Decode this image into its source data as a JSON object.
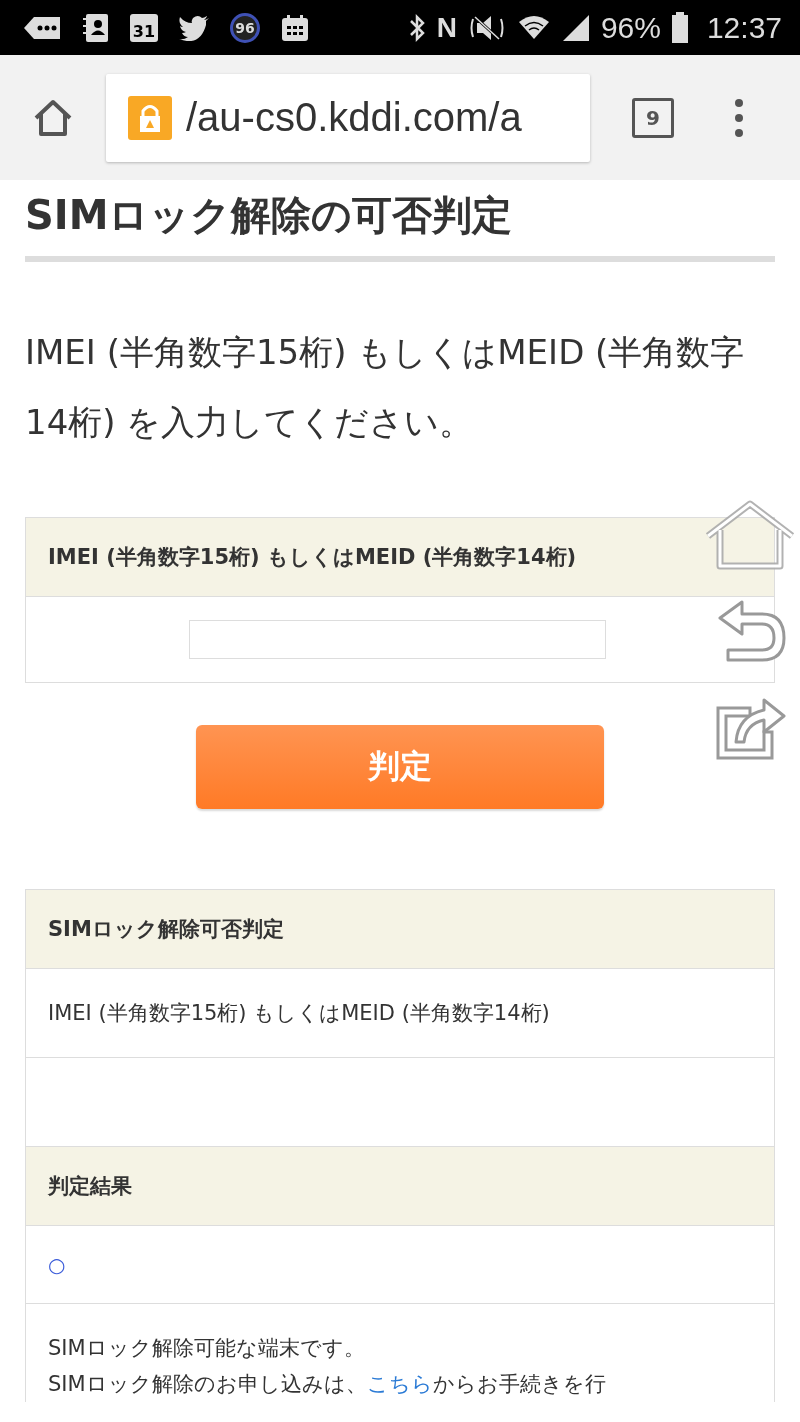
{
  "status_bar": {
    "calendar_day": "31",
    "badge_count": "96",
    "nfc": "N",
    "battery": "96%",
    "time": "12:37"
  },
  "browser": {
    "url": "/au-cs0.kddi.com/a",
    "tab_count": "9"
  },
  "page": {
    "title": "SIMロック解除の可否判定",
    "intro": "IMEI (半角数字15桁) もしくはMEID (半角数字14桁) を入力してください。",
    "form": {
      "label": "IMEI (半角数字15桁) もしくはMEID (半角数字14桁)"
    },
    "submit": "判定",
    "result_table": [
      {
        "kind": "header",
        "text": "SIMロック解除可否判定"
      },
      {
        "kind": "cell",
        "text": "IMEI (半角数字15桁) もしくはMEID (半角数字14桁)"
      },
      {
        "kind": "empty"
      },
      {
        "kind": "header",
        "text": "判定結果"
      },
      {
        "kind": "mark",
        "text": "○"
      },
      {
        "kind": "message",
        "lines": [
          {
            "parts": [
              {
                "kind": "text",
                "text": "SIMロック解除可能な端末です。"
              }
            ]
          },
          {
            "parts": [
              {
                "kind": "text",
                "text": "SIMロック解除のお申し込みは、"
              },
              {
                "kind": "link",
                "text": "こちら"
              },
              {
                "kind": "text",
                "text": "からお手続きを行"
              }
            ]
          }
        ]
      }
    ]
  }
}
